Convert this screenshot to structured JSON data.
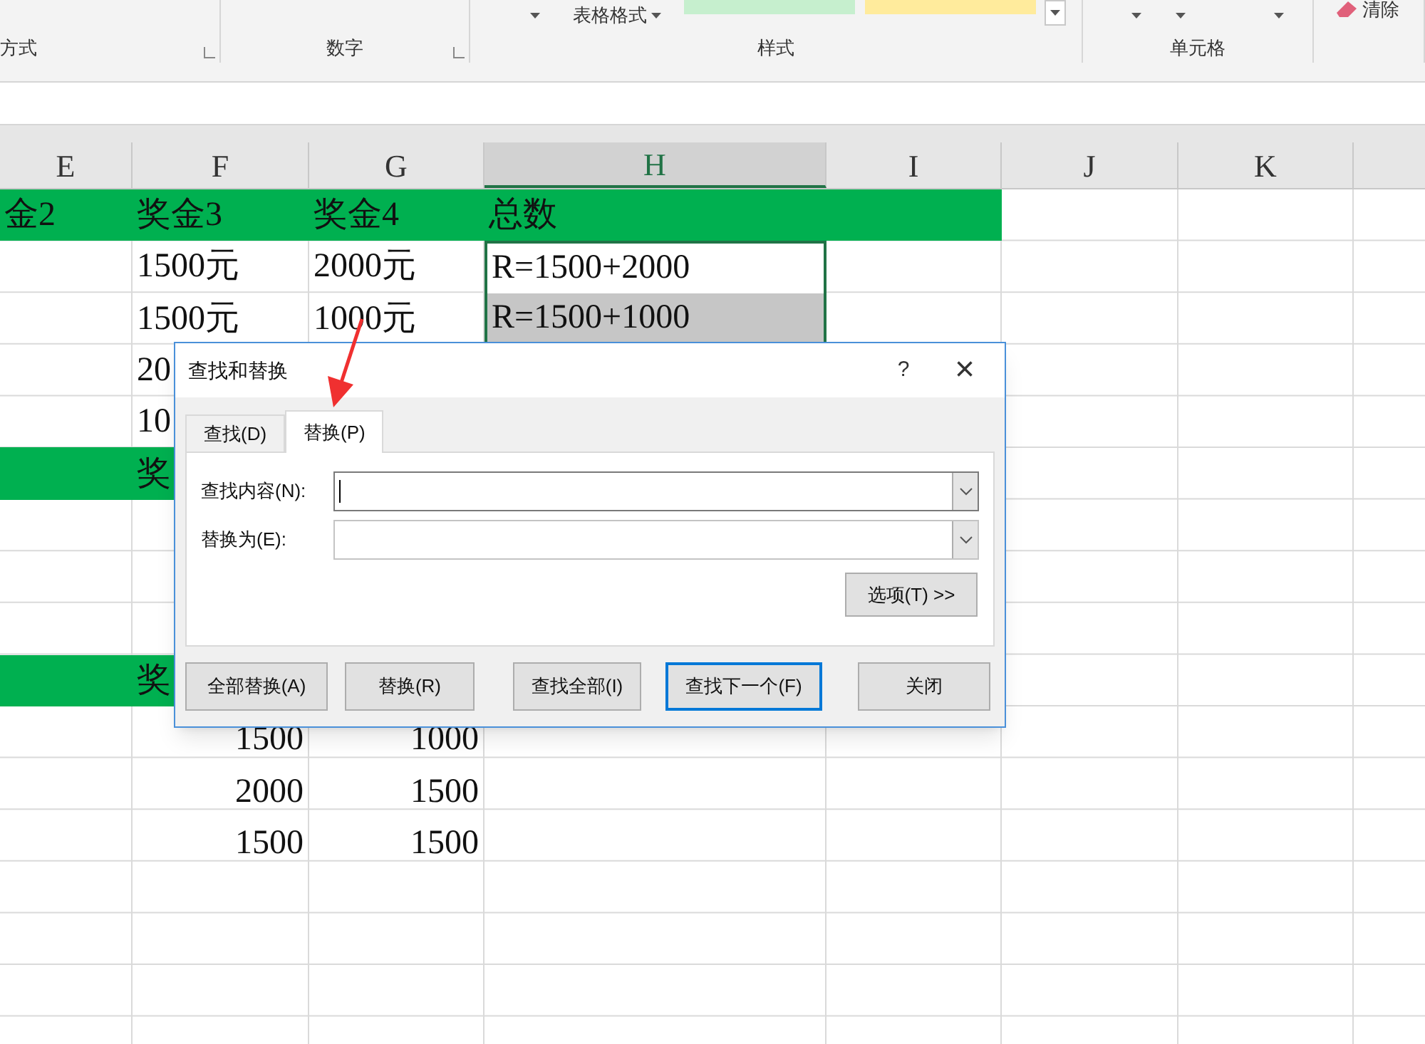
{
  "ribbon": {
    "groups": [
      {
        "label": "方式",
        "launcher": true
      },
      {
        "label": "数字",
        "launcher": true
      },
      {
        "label": "样式",
        "launcher": false,
        "button": "表格格式"
      },
      {
        "label": "单元格",
        "launcher": false
      },
      {
        "launcher": false,
        "button": "清除"
      }
    ]
  },
  "columns": [
    {
      "label": "E",
      "selected": false
    },
    {
      "label": "F",
      "selected": false
    },
    {
      "label": "G",
      "selected": false
    },
    {
      "label": "H",
      "selected": true
    },
    {
      "label": "I",
      "selected": false
    },
    {
      "label": "J",
      "selected": false
    },
    {
      "label": "K",
      "selected": false
    }
  ],
  "rows": [
    {
      "kind": "band",
      "cells": [
        {
          "text": "金2",
          "selected": false,
          "active": false
        },
        {
          "text": "奖金3",
          "selected": false,
          "active": false
        },
        {
          "text": "奖金4",
          "selected": false,
          "active": false
        },
        {
          "text": "总数",
          "selected": false,
          "active": false
        }
      ]
    },
    {
      "kind": "text",
      "cells": [
        null,
        {
          "text": "1500元",
          "selected": false,
          "active": false
        },
        {
          "text": "2000元",
          "selected": false,
          "active": false
        },
        {
          "text": "R=1500+2000",
          "selected": true,
          "active": true
        }
      ]
    },
    {
      "kind": "text",
      "cells": [
        null,
        {
          "text": "1500元",
          "selected": false,
          "active": false
        },
        {
          "text": "1000元",
          "selected": false,
          "active": false
        },
        {
          "text": "R=1500+1000",
          "selected": true,
          "active": false
        }
      ]
    },
    {
      "kind": "text",
      "cells": [
        null,
        {
          "text": "20",
          "selected": false,
          "active": false
        }
      ]
    },
    {
      "kind": "text",
      "cells": [
        null,
        {
          "text": "10",
          "selected": false,
          "active": false
        }
      ]
    },
    {
      "kind": "band",
      "cells": [
        null,
        {
          "text": "奖",
          "selected": false,
          "active": false
        }
      ]
    },
    {
      "kind": "text",
      "cells": []
    },
    {
      "kind": "text",
      "cells": []
    },
    {
      "kind": "text",
      "cells": []
    },
    {
      "kind": "band",
      "cells": [
        null,
        {
          "text": "奖",
          "selected": false,
          "active": false
        }
      ]
    },
    {
      "kind": "number",
      "cells": [
        null,
        {
          "text": "1500",
          "selected": false,
          "active": false
        },
        {
          "text": "1000",
          "selected": false,
          "active": false
        }
      ]
    },
    {
      "kind": "number",
      "cells": [
        null,
        {
          "text": "2000",
          "selected": false,
          "active": false
        },
        {
          "text": "1500",
          "selected": false,
          "active": false
        }
      ]
    },
    {
      "kind": "number",
      "cells": [
        null,
        {
          "text": "1500",
          "selected": false,
          "active": false
        },
        {
          "text": "1500",
          "selected": false,
          "active": false
        }
      ]
    },
    {
      "kind": "text",
      "cells": []
    },
    {
      "kind": "text",
      "cells": []
    },
    {
      "kind": "text",
      "cells": []
    },
    {
      "kind": "text",
      "cells": []
    }
  ],
  "dialog": {
    "title": "查找和替换",
    "help": "?",
    "close": "×",
    "tabs": [
      {
        "label": "查找(D)",
        "selected": false
      },
      {
        "label": "替换(P)",
        "selected": true
      }
    ],
    "fields": [
      {
        "label": "查找内容(N):",
        "focused": true
      },
      {
        "label": "替换为(E):",
        "focused": false
      }
    ],
    "options_button": "选项(T) >>",
    "buttons": [
      {
        "label": "全部替换(A)",
        "default": false
      },
      {
        "label": "替换(R)",
        "default": false
      },
      {
        "label": "查找全部(I)",
        "default": false
      },
      {
        "label": "查找下一个(F)",
        "default": true
      },
      {
        "label": "关闭",
        "default": false
      }
    ]
  }
}
